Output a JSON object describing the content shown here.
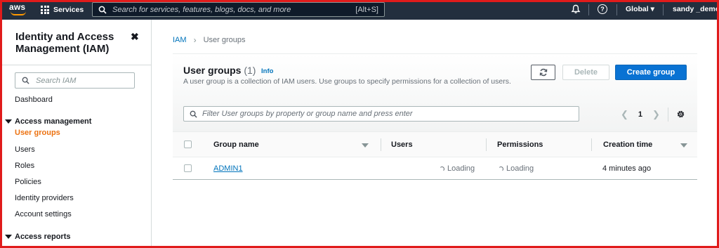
{
  "topbar": {
    "logo_text": "aws",
    "services_label": "Services",
    "search_placeholder": "Search for services, features, blogs, docs, and more",
    "search_shortcut": "[Alt+S]",
    "region_label": "Global ▾",
    "user_label": "sandy _demo _"
  },
  "sidebar": {
    "title": "Identity and Access Management (IAM)",
    "close_glyph": "✖",
    "search_placeholder": "Search IAM",
    "dashboard": "Dashboard",
    "access_management": {
      "label": "Access management",
      "items": [
        "User groups",
        "Users",
        "Roles",
        "Policies",
        "Identity providers",
        "Account settings"
      ]
    },
    "access_reports_label": "Access reports"
  },
  "breadcrumb": {
    "root": "IAM",
    "current": "User groups"
  },
  "panel": {
    "title": "User groups",
    "count": "(1)",
    "info_link": "Info",
    "description": "A user group is a collection of IAM users. Use groups to specify permissions for a collection of users.",
    "delete_label": "Delete",
    "create_label": "Create group",
    "filter_placeholder": "Filter User groups by property or group name and press enter",
    "page_number": "1"
  },
  "table": {
    "columns": [
      "Group name",
      "Users",
      "Permissions",
      "Creation time"
    ],
    "rows": [
      {
        "group_name": "ADMIN1",
        "users": "Loading",
        "permissions": "Loading",
        "creation_time": "4 minutes ago"
      }
    ]
  },
  "colors": {
    "topbar_bg": "#232f3e",
    "brand_orange": "#ff9900",
    "link_blue": "#0073bb",
    "primary_button": "#0972d3",
    "active_nav": "#ec7211",
    "frame_red": "#e01b1b"
  },
  "icons": [
    "grid-icon",
    "search-icon",
    "bell-icon",
    "help-icon",
    "close-icon",
    "refresh-icon",
    "settings-gear-icon",
    "chevron-left-icon",
    "chevron-right-icon",
    "sort-icon",
    "spinner-icon"
  ]
}
